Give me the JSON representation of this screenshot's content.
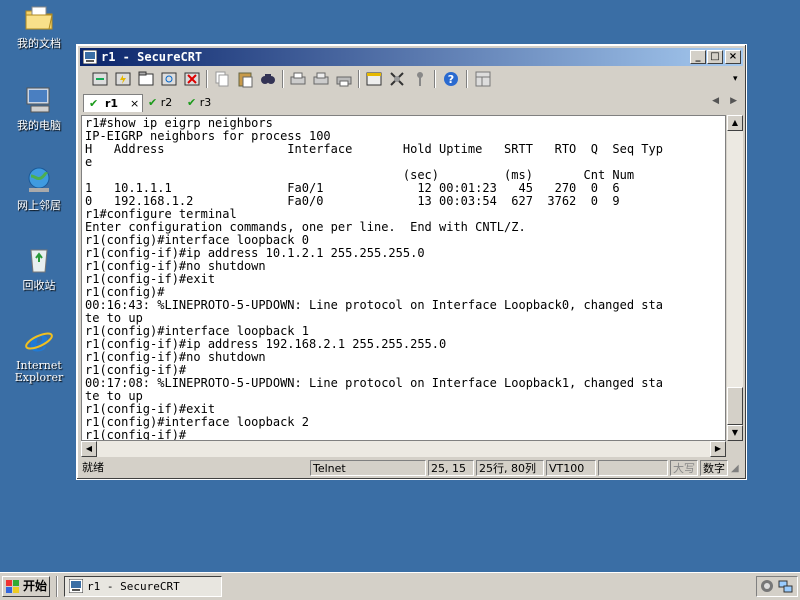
{
  "desktop": {
    "icons": [
      {
        "label": "我的文档"
      },
      {
        "label": "我的电脑"
      },
      {
        "label": "网上邻居"
      },
      {
        "label": "回收站"
      },
      {
        "label": "Internet Explorer"
      }
    ]
  },
  "window": {
    "title": "r1 - SecureCRT",
    "controls": {
      "minimize": "_",
      "maximize": "□",
      "close": "×"
    }
  },
  "tabs": [
    {
      "label": "r1",
      "close": "×",
      "status": "connected",
      "active": true
    },
    {
      "label": "r2",
      "status": "connected",
      "active": false
    },
    {
      "label": "r3",
      "status": "connected",
      "active": false
    }
  ],
  "tab_nav": {
    "prev": "◀",
    "next": "▶"
  },
  "terminal": {
    "lines": [
      "r1#show ip eigrp neighbors",
      "IP-EIGRP neighbors for process 100",
      "H   Address                 Interface       Hold Uptime   SRTT   RTO  Q  Seq Typ",
      "e",
      "                                            (sec)         (ms)       Cnt Num",
      "1   10.1.1.1                Fa0/1             12 00:01:23   45   270  0  6",
      "0   192.168.1.2             Fa0/0             13 00:03:54  627  3762  0  9",
      "r1#configure terminal",
      "Enter configuration commands, one per line.  End with CNTL/Z.",
      "r1(config)#interface loopback 0",
      "r1(config-if)#ip address 10.1.2.1 255.255.255.0",
      "r1(config-if)#no shutdown",
      "r1(config-if)#exit",
      "r1(config)#",
      "00:16:43: %LINEPROTO-5-UPDOWN: Line protocol on Interface Loopback0, changed sta",
      "te to up",
      "r1(config)#interface loopback 1",
      "r1(config-if)#ip address 192.168.2.1 255.255.255.0",
      "r1(config-if)#no shutdown",
      "r1(config-if)#",
      "00:17:08: %LINEPROTO-5-UPDOWN: Line protocol on Interface Loopback1, changed sta",
      "te to up",
      "r1(config-if)#exit",
      "r1(config)#interface loopback 2",
      "r1(config-if)#"
    ]
  },
  "statusbar": {
    "ready": "就绪",
    "protocol": "Telnet",
    "cursor": "25, 15",
    "size": "25行, 80列",
    "emulation": "VT100",
    "caps": "大写",
    "num": "数字"
  },
  "taskbar": {
    "start_label": "开始",
    "item": "r1 - SecureCRT"
  },
  "colors": {
    "desktop": "#3a6ea5",
    "titlebar_start": "#0a246a",
    "titlebar_end": "#a6caf0",
    "tab_check": "#1a9a1a"
  }
}
